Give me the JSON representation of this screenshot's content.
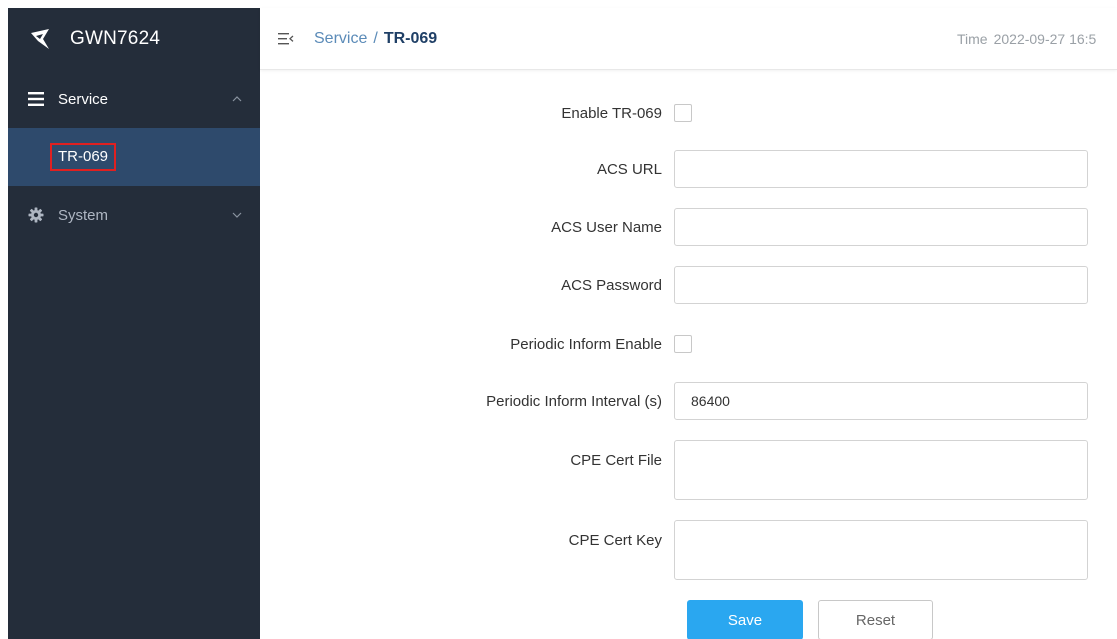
{
  "sidebar": {
    "brand": "GWN7624",
    "groups": [
      {
        "label": "Service",
        "icon": "menu-icon",
        "expanded": true,
        "items": [
          {
            "label": "TR-069",
            "active": true
          }
        ]
      },
      {
        "label": "System",
        "icon": "gear-icon",
        "expanded": false
      }
    ]
  },
  "header": {
    "breadcrumb_parent": "Service",
    "breadcrumb_separator": "/",
    "breadcrumb_current": "TR-069",
    "time_label": "Time",
    "time_value": "2022-09-27 16:5"
  },
  "form": {
    "enable_tr069": {
      "label": "Enable TR-069",
      "checked": false
    },
    "acs_url": {
      "label": "ACS URL",
      "value": ""
    },
    "acs_user_name": {
      "label": "ACS User Name",
      "value": ""
    },
    "acs_password": {
      "label": "ACS Password",
      "value": ""
    },
    "periodic_inform_enable": {
      "label": "Periodic Inform Enable",
      "checked": false
    },
    "periodic_inform_interval": {
      "label": "Periodic Inform Interval (s)",
      "value": "86400"
    },
    "cpe_cert_file": {
      "label": "CPE Cert File",
      "value": ""
    },
    "cpe_cert_key": {
      "label": "CPE Cert Key",
      "value": ""
    },
    "save_label": "Save",
    "reset_label": "Reset"
  },
  "colors": {
    "sidebar_bg": "#242d3a",
    "sidebar_active_bg": "#2e4a6c",
    "highlight_box": "#e02020",
    "primary_button": "#2aa7f0",
    "breadcrumb_link": "#5b8bb8"
  }
}
